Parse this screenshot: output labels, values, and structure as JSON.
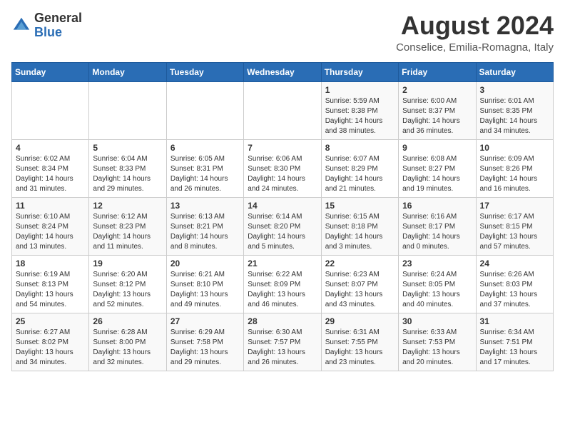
{
  "logo": {
    "general": "General",
    "blue": "Blue"
  },
  "title": {
    "month_year": "August 2024",
    "location": "Conselice, Emilia-Romagna, Italy"
  },
  "days_of_week": [
    "Sunday",
    "Monday",
    "Tuesday",
    "Wednesday",
    "Thursday",
    "Friday",
    "Saturday"
  ],
  "weeks": [
    [
      {
        "day": "",
        "content": ""
      },
      {
        "day": "",
        "content": ""
      },
      {
        "day": "",
        "content": ""
      },
      {
        "day": "",
        "content": ""
      },
      {
        "day": "1",
        "content": "Sunrise: 5:59 AM\nSunset: 8:38 PM\nDaylight: 14 hours and 38 minutes."
      },
      {
        "day": "2",
        "content": "Sunrise: 6:00 AM\nSunset: 8:37 PM\nDaylight: 14 hours and 36 minutes."
      },
      {
        "day": "3",
        "content": "Sunrise: 6:01 AM\nSunset: 8:35 PM\nDaylight: 14 hours and 34 minutes."
      }
    ],
    [
      {
        "day": "4",
        "content": "Sunrise: 6:02 AM\nSunset: 8:34 PM\nDaylight: 14 hours and 31 minutes."
      },
      {
        "day": "5",
        "content": "Sunrise: 6:04 AM\nSunset: 8:33 PM\nDaylight: 14 hours and 29 minutes."
      },
      {
        "day": "6",
        "content": "Sunrise: 6:05 AM\nSunset: 8:31 PM\nDaylight: 14 hours and 26 minutes."
      },
      {
        "day": "7",
        "content": "Sunrise: 6:06 AM\nSunset: 8:30 PM\nDaylight: 14 hours and 24 minutes."
      },
      {
        "day": "8",
        "content": "Sunrise: 6:07 AM\nSunset: 8:29 PM\nDaylight: 14 hours and 21 minutes."
      },
      {
        "day": "9",
        "content": "Sunrise: 6:08 AM\nSunset: 8:27 PM\nDaylight: 14 hours and 19 minutes."
      },
      {
        "day": "10",
        "content": "Sunrise: 6:09 AM\nSunset: 8:26 PM\nDaylight: 14 hours and 16 minutes."
      }
    ],
    [
      {
        "day": "11",
        "content": "Sunrise: 6:10 AM\nSunset: 8:24 PM\nDaylight: 14 hours and 13 minutes."
      },
      {
        "day": "12",
        "content": "Sunrise: 6:12 AM\nSunset: 8:23 PM\nDaylight: 14 hours and 11 minutes."
      },
      {
        "day": "13",
        "content": "Sunrise: 6:13 AM\nSunset: 8:21 PM\nDaylight: 14 hours and 8 minutes."
      },
      {
        "day": "14",
        "content": "Sunrise: 6:14 AM\nSunset: 8:20 PM\nDaylight: 14 hours and 5 minutes."
      },
      {
        "day": "15",
        "content": "Sunrise: 6:15 AM\nSunset: 8:18 PM\nDaylight: 14 hours and 3 minutes."
      },
      {
        "day": "16",
        "content": "Sunrise: 6:16 AM\nSunset: 8:17 PM\nDaylight: 14 hours and 0 minutes."
      },
      {
        "day": "17",
        "content": "Sunrise: 6:17 AM\nSunset: 8:15 PM\nDaylight: 13 hours and 57 minutes."
      }
    ],
    [
      {
        "day": "18",
        "content": "Sunrise: 6:19 AM\nSunset: 8:13 PM\nDaylight: 13 hours and 54 minutes."
      },
      {
        "day": "19",
        "content": "Sunrise: 6:20 AM\nSunset: 8:12 PM\nDaylight: 13 hours and 52 minutes."
      },
      {
        "day": "20",
        "content": "Sunrise: 6:21 AM\nSunset: 8:10 PM\nDaylight: 13 hours and 49 minutes."
      },
      {
        "day": "21",
        "content": "Sunrise: 6:22 AM\nSunset: 8:09 PM\nDaylight: 13 hours and 46 minutes."
      },
      {
        "day": "22",
        "content": "Sunrise: 6:23 AM\nSunset: 8:07 PM\nDaylight: 13 hours and 43 minutes."
      },
      {
        "day": "23",
        "content": "Sunrise: 6:24 AM\nSunset: 8:05 PM\nDaylight: 13 hours and 40 minutes."
      },
      {
        "day": "24",
        "content": "Sunrise: 6:26 AM\nSunset: 8:03 PM\nDaylight: 13 hours and 37 minutes."
      }
    ],
    [
      {
        "day": "25",
        "content": "Sunrise: 6:27 AM\nSunset: 8:02 PM\nDaylight: 13 hours and 34 minutes."
      },
      {
        "day": "26",
        "content": "Sunrise: 6:28 AM\nSunset: 8:00 PM\nDaylight: 13 hours and 32 minutes."
      },
      {
        "day": "27",
        "content": "Sunrise: 6:29 AM\nSunset: 7:58 PM\nDaylight: 13 hours and 29 minutes."
      },
      {
        "day": "28",
        "content": "Sunrise: 6:30 AM\nSunset: 7:57 PM\nDaylight: 13 hours and 26 minutes."
      },
      {
        "day": "29",
        "content": "Sunrise: 6:31 AM\nSunset: 7:55 PM\nDaylight: 13 hours and 23 minutes."
      },
      {
        "day": "30",
        "content": "Sunrise: 6:33 AM\nSunset: 7:53 PM\nDaylight: 13 hours and 20 minutes."
      },
      {
        "day": "31",
        "content": "Sunrise: 6:34 AM\nSunset: 7:51 PM\nDaylight: 13 hours and 17 minutes."
      }
    ]
  ]
}
